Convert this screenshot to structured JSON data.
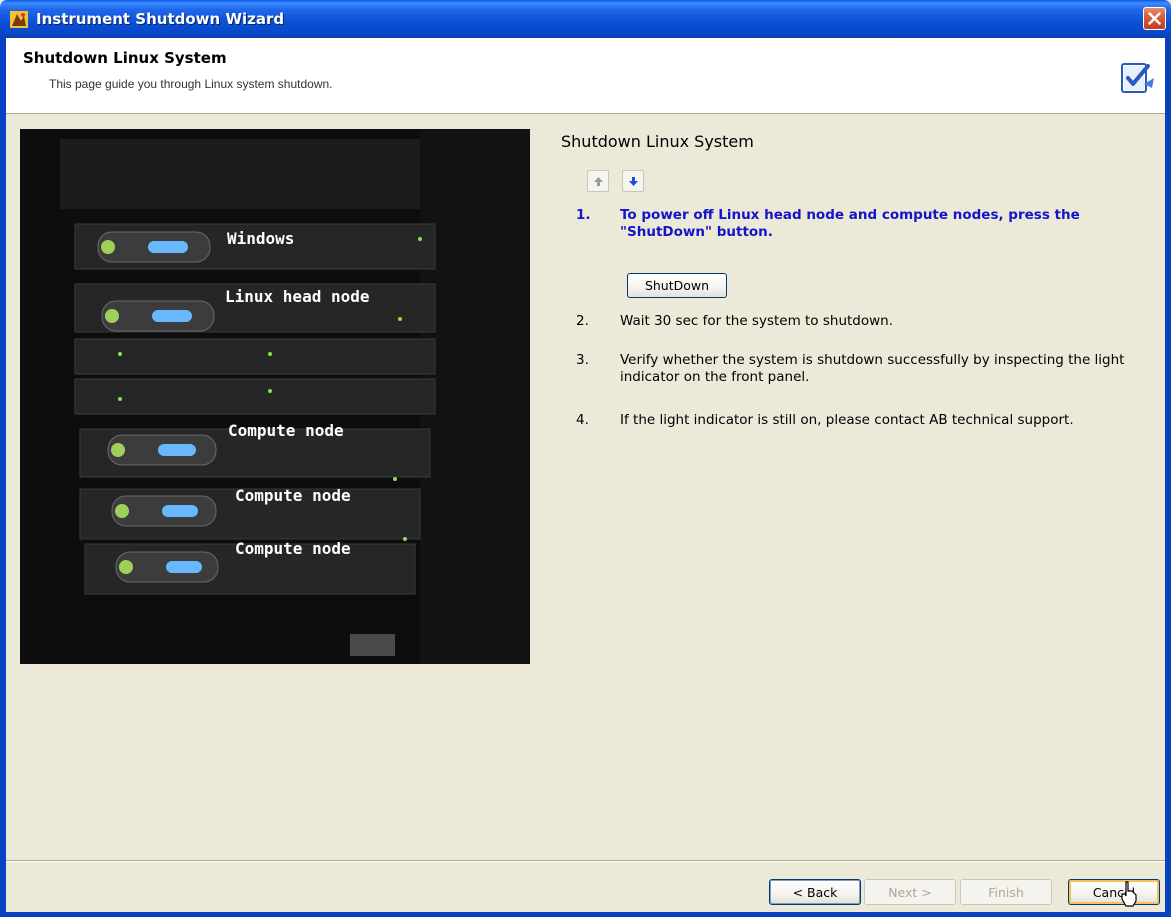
{
  "window": {
    "title": "Instrument Shutdown Wizard"
  },
  "header": {
    "title": "Shutdown Linux System",
    "subtitle": "This page guide you through Linux system shutdown."
  },
  "image": {
    "labels": [
      "Windows",
      "Linux head node",
      "Compute node",
      "Compute node",
      "Compute node"
    ]
  },
  "panel": {
    "title": "Shutdown Linux System",
    "steps": [
      {
        "number": "1.",
        "text": "To power off Linux head node and compute nodes, press the \"ShutDown\" button."
      },
      {
        "number": "2.",
        "text": "Wait 30 sec for the system to shutdown."
      },
      {
        "number": "3.",
        "text": "Verify whether the system is shutdown successfully by inspecting the light indicator on the front panel."
      },
      {
        "number": "4.",
        "text": "If the light indicator is still on, please contact AB technical support."
      }
    ],
    "shutdown_button": "ShutDown"
  },
  "footer": {
    "back": "< Back",
    "next": "Next >",
    "finish": "Finish",
    "cancel": "Cancel"
  },
  "icons": {
    "app": "instrument-app-icon",
    "close": "close-icon",
    "header": "checklist-icon",
    "up": "arrow-up-icon",
    "down": "arrow-down-icon"
  }
}
